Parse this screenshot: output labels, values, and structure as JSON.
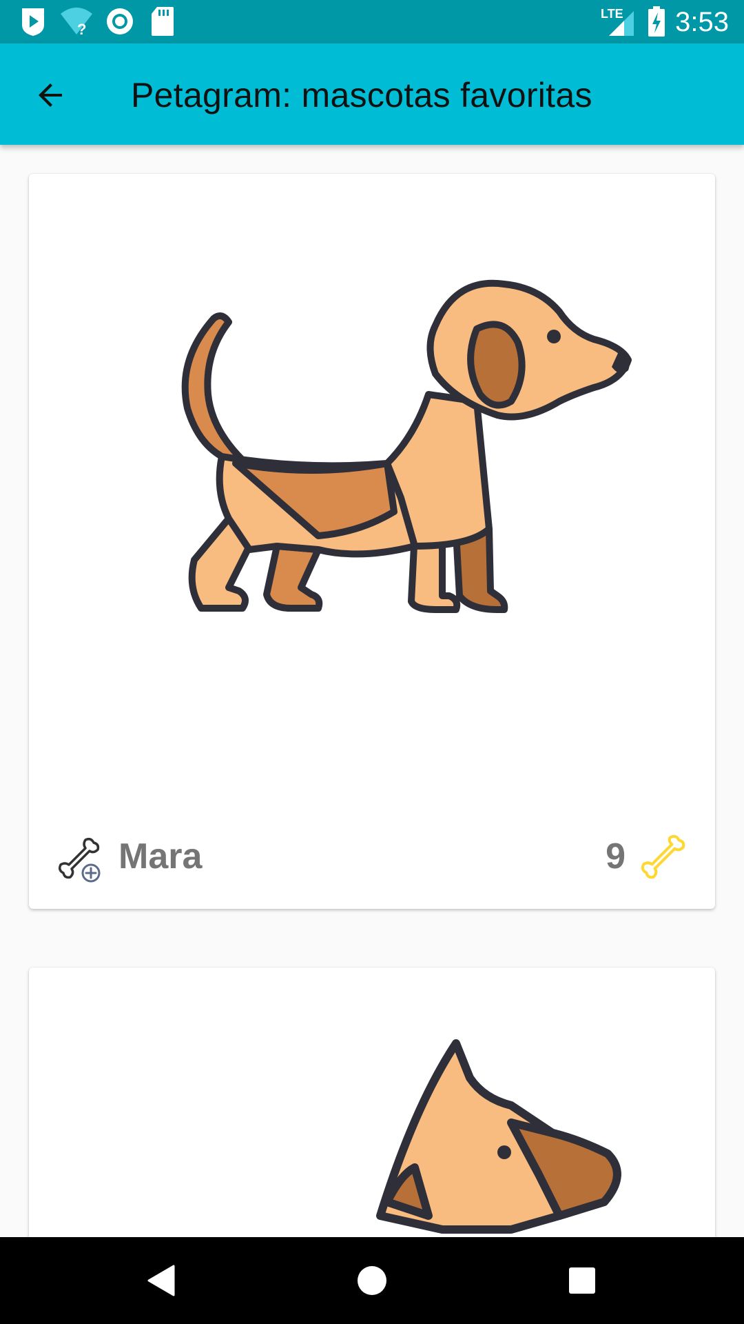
{
  "status_bar": {
    "time": "3:53",
    "network_label": "LTE",
    "icons": [
      "play-store-icon",
      "wifi-unknown-icon",
      "sync-circle-icon",
      "sd-card-icon",
      "signal-icon",
      "battery-charging-icon"
    ]
  },
  "app_bar": {
    "title": "Petagram: mascotas favoritas",
    "back_icon": "arrow-back-icon"
  },
  "pets": [
    {
      "name": "Mara",
      "likes": "9",
      "image": "dog-illustration",
      "rate_icon": "bone-add-icon",
      "like_icon": "bone-icon"
    }
  ],
  "colors": {
    "status_bar": "#0097a7",
    "app_bar": "#00bcd4",
    "background": "#fafafa",
    "card": "#ffffff",
    "footer_text": "#757575",
    "bone_yellow": "#fdd835",
    "dog_light": "#f8bb80",
    "dog_mid": "#d98b4d",
    "dog_dark": "#b87039"
  },
  "nav_bar": {
    "icons": [
      "back-triangle-icon",
      "home-circle-icon",
      "recents-square-icon"
    ]
  }
}
